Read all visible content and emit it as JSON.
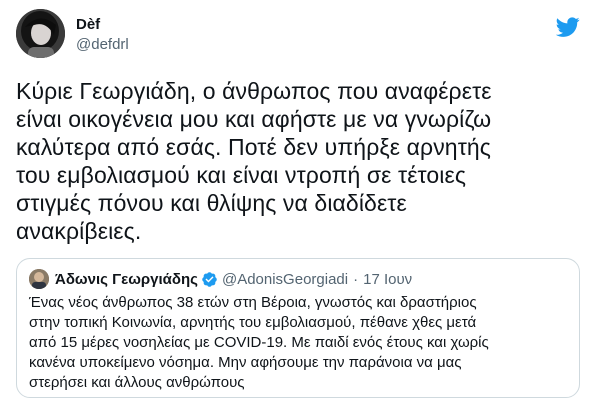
{
  "tweet": {
    "author": {
      "display_name": "Dèf",
      "handle": "@defdrl"
    },
    "text": "Κύριε Γεωργιάδη, ο άνθρωπος που αναφέρετε\nείναι οικογένεια μου και αφήστε με να γνωρίζω\nκαλύτερα από εσάς. Ποτέ δεν υπήρξε αρνητής\nτου εμβολιασμού και είναι ντροπή σε τέτοιες\nστιγμές πόνου και θλίψης να διαδίδετε\nανακρίβειες.",
    "quoted": {
      "display_name": "Άδωνις Γεωργιάδης",
      "handle": "@AdonisGeorgiadi",
      "separator": "·",
      "date": "17 Ιουν",
      "text": "Ένας νέος άνθρωπος 38 ετών στη Βέροια, γνωστός και δραστήριος\nστην τοπική Κοινωνία, αρνητής του εμβολιασμού, πέθανε χθες μετά\nαπό 15 μέρες νοσηλείας με COVID-19. Με παιδί ενός έτους και χωρίς\nκανένα υποκείμενο νόσημα. Μην αφήσουμε την παράνοια να μας\nστερήσει και άλλους ανθρώπους"
    }
  },
  "icons": {
    "logo": "twitter-bird-icon",
    "verified": "verified-badge-icon"
  },
  "colors": {
    "brand": "#1d9bf0",
    "text": "#0f1419",
    "secondary": "#536471",
    "border": "#cfd9de"
  }
}
